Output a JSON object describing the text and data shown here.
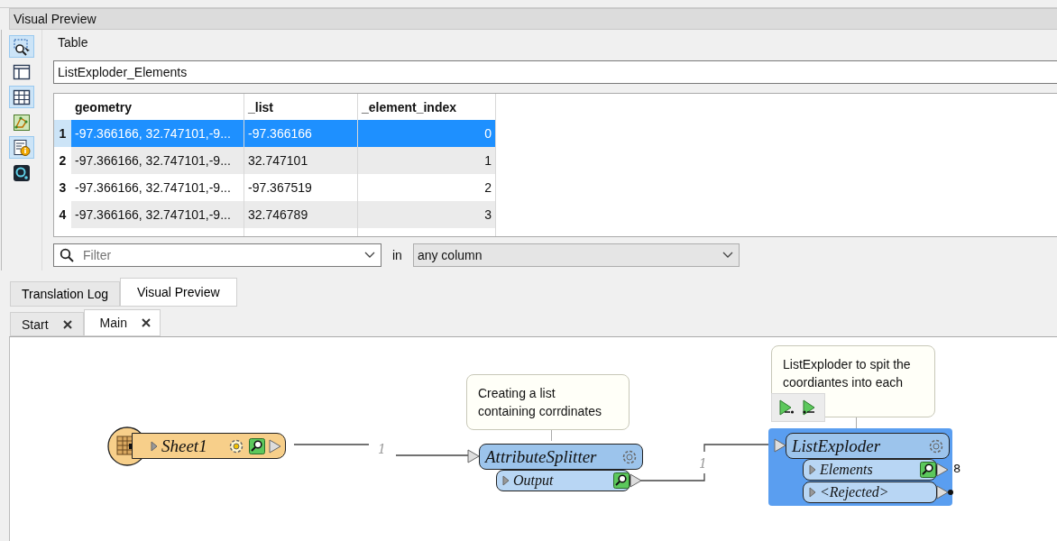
{
  "panel": {
    "title": "Visual Preview"
  },
  "toolbar": [
    {
      "kind": "select",
      "on": true
    },
    {
      "kind": "layout",
      "on": false
    },
    {
      "kind": "table",
      "on": true
    },
    {
      "kind": "graph",
      "on": false
    },
    {
      "kind": "info",
      "on": true
    },
    {
      "kind": "viewer",
      "on": false
    }
  ],
  "table": {
    "group_label": "Table",
    "source": "ListExploder_Elements",
    "columns": [
      "geometry",
      "_list",
      "_element_index"
    ],
    "rows": [
      {
        "number": "1",
        "cells": [
          "-97.366166, 32.747101,-9...",
          "-97.366166",
          "0"
        ],
        "selected": true
      },
      {
        "number": "2",
        "cells": [
          "-97.366166, 32.747101,-9...",
          "32.747101",
          "1"
        ],
        "selected": false
      },
      {
        "number": "3",
        "cells": [
          "-97.366166, 32.747101,-9...",
          "-97.367519",
          "2"
        ],
        "selected": false
      },
      {
        "number": "4",
        "cells": [
          "-97.366166, 32.747101,-9...",
          "32.746789",
          "3"
        ],
        "selected": false
      }
    ]
  },
  "filter": {
    "placeholder": "Filter",
    "in_label": "in",
    "column_choice": "any column"
  },
  "bottom_tabs": [
    {
      "label": "Translation Log",
      "selected": false
    },
    {
      "label": "Visual Preview",
      "selected": true
    }
  ],
  "doc_tabs": [
    {
      "label": "Start",
      "selected": false
    },
    {
      "label": "Main",
      "selected": true
    }
  ],
  "canvas": {
    "annotations": [
      {
        "text": "Creating a list\ncontaining corrdinates"
      },
      {
        "text": "ListExploder to spit the\ncoordiantes into each"
      }
    ],
    "nodes": [
      {
        "kind": "reader",
        "name": "Sheet1",
        "selected": false
      },
      {
        "kind": "transformer",
        "name": "AttributeSplitter",
        "selected": false,
        "ports": [
          {
            "name": "Output",
            "inspected": true
          }
        ]
      },
      {
        "kind": "transformer",
        "name": "ListExploder",
        "selected": true,
        "ports": [
          {
            "name": "Elements",
            "inspected": true,
            "count": "8"
          },
          {
            "name": "<Rejected>",
            "inspected": false
          }
        ]
      }
    ],
    "connection_labels": [
      "1",
      "1"
    ]
  }
}
